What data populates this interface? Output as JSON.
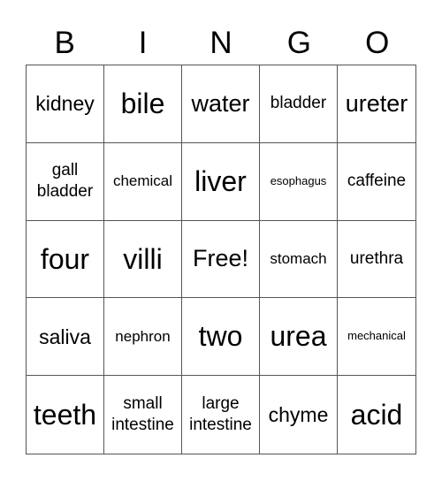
{
  "header": {
    "letters": [
      "B",
      "I",
      "N",
      "G",
      "O"
    ]
  },
  "grid": {
    "rows": [
      [
        "kidney",
        "bile",
        "water",
        "bladder",
        "ureter"
      ],
      [
        "gall bladder",
        "chemical",
        "liver",
        "esophagus",
        "caffeine"
      ],
      [
        "four",
        "villi",
        "Free!",
        "stomach",
        "urethra"
      ],
      [
        "saliva",
        "nephron",
        "two",
        "urea",
        "mechanical"
      ],
      [
        "teeth",
        "small intestine",
        "large intestine",
        "chyme",
        "acid"
      ]
    ]
  }
}
